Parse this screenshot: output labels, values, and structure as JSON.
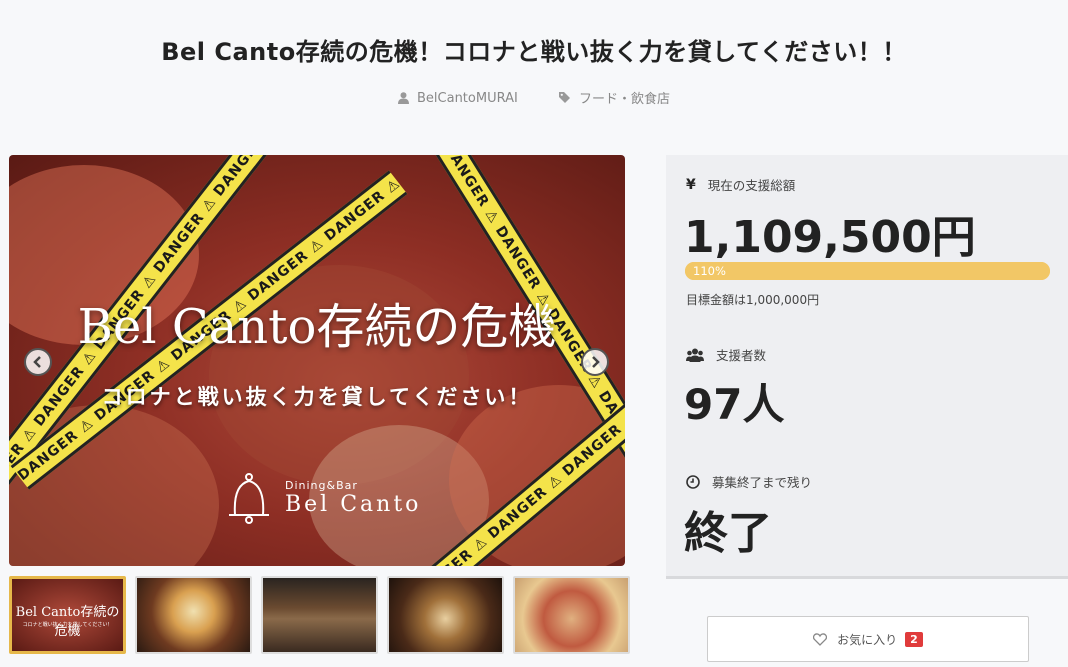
{
  "project": {
    "title": "Bel Canto存続の危機！コロナと戦い抜く力を貸してください！！",
    "owner": "BelCantoMURAI",
    "category": "フード・飲食店"
  },
  "hero": {
    "tape_text": "DANGER ⚠ DANGER ⚠ DANGER ⚠ DANGER ⚠ DANGER ⚠ DANGER ⚠ DANGER ⚠",
    "headline": "Bel Canto存続の危機",
    "subheadline": "コロナと戦い抜く力を貸してください！",
    "logo_small": "Dining&Bar",
    "logo_big": "Bel Canto",
    "prev_icon": "chevron-left-icon",
    "next_icon": "chevron-right-icon"
  },
  "thumbnails": [
    {
      "name": "thumb-main-visual",
      "title": "Bel Canto存続の危機",
      "sub": "コロナと戦い抜く力を貸してください！",
      "active": true
    },
    {
      "name": "thumb-skillet-dish",
      "active": false
    },
    {
      "name": "thumb-bar-interior",
      "active": false
    },
    {
      "name": "thumb-nuts-dish",
      "active": false
    },
    {
      "name": "thumb-pizza",
      "active": false
    }
  ],
  "stats": {
    "total_label": "現在の支援総額",
    "total_value": "1,109,500円",
    "progress_label": "110%",
    "progress_percent": 110,
    "goal_text": "目標金額は1,000,000円",
    "supporters_label": "支援者数",
    "supporters_value": "97人",
    "remaining_label": "募集終了まで残り",
    "remaining_value": "終了"
  },
  "favorite": {
    "label": "お気に入り",
    "count": "2"
  },
  "colors": {
    "accent": "#f2c766",
    "badge": "#e03b3b",
    "tape": "#f4e34a"
  }
}
